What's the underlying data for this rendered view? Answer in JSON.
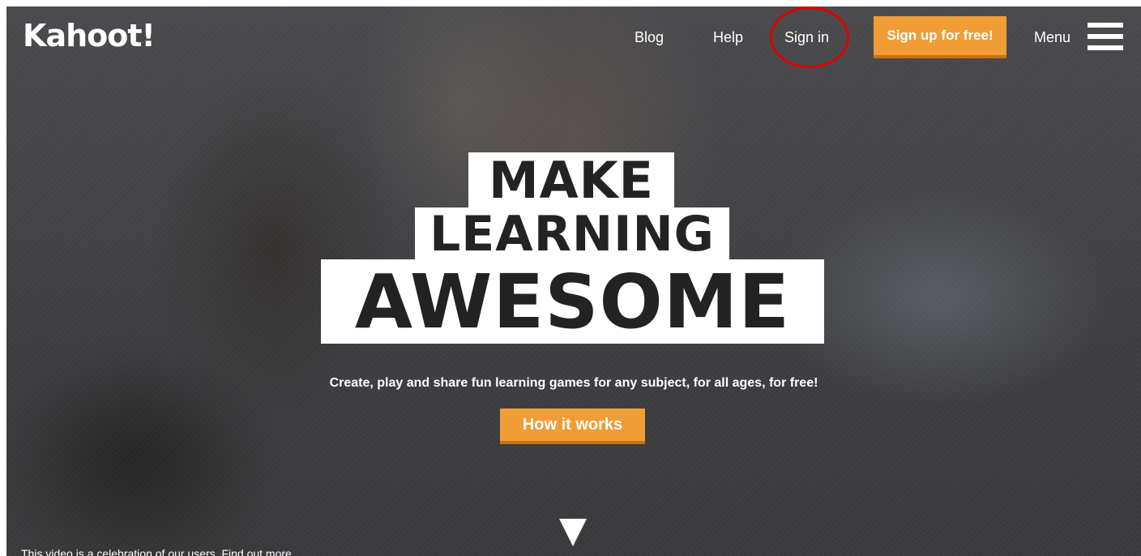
{
  "header": {
    "logo_text": "Kahoot!",
    "nav": {
      "blog": "Blog",
      "help": "Help",
      "sign_in": "Sign in"
    },
    "signup_label": "Sign up for free!",
    "menu_label": "Menu"
  },
  "hero": {
    "line1": "MAKE",
    "line2": "LEARNING",
    "line3": "AWESOME",
    "tagline": "Create, play and share fun learning games for any subject, for all ages, for free!",
    "cta_label": "How it works"
  },
  "footer": {
    "note": "This video is a celebration of our users. Find out more"
  },
  "colors": {
    "accent": "#f19d37",
    "accent_shadow": "#c6721a",
    "highlight_ring": "#e00000",
    "hero_text": "#232323"
  },
  "icons": [
    "hamburger-menu-icon",
    "scroll-down-arrow-icon"
  ]
}
